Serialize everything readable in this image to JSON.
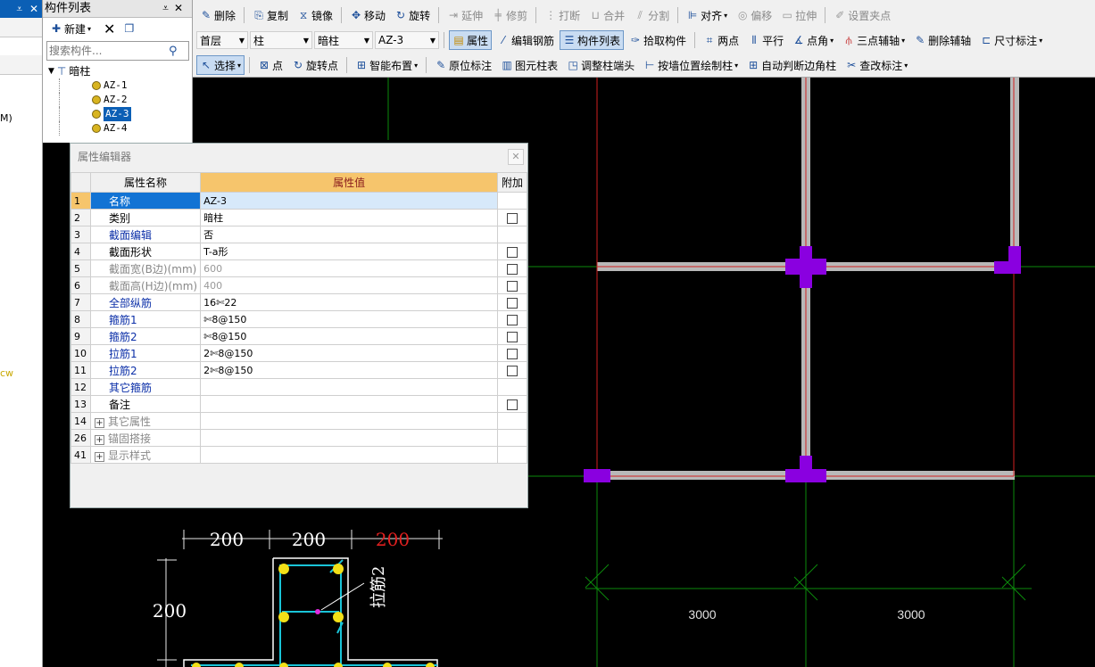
{
  "left_panel": {
    "pin_label": "⩡",
    "close_label": "✕",
    "fragment_1": "M)",
    "fragment_2": "cw"
  },
  "component_list": {
    "title": "构件列表",
    "pin_label": "⩡",
    "close_label": "✕",
    "new_label": "新建",
    "search_placeholder": "搜索构件...",
    "tree_root": "暗柱",
    "items": [
      "AZ-1",
      "AZ-2",
      "AZ-3",
      "AZ-4"
    ],
    "selected": "AZ-3"
  },
  "toolbar1": {
    "delete": "删除",
    "copy": "复制",
    "mirror": "镜像",
    "move": "移动",
    "rotate": "旋转",
    "extend": "延伸",
    "trim": "修剪",
    "break": "打断",
    "merge": "合并",
    "split": "分割",
    "align": "对齐",
    "offset": "偏移",
    "stretch": "拉伸",
    "set_grip": "设置夹点"
  },
  "toolbar2": {
    "floor": "首层",
    "type": "柱",
    "subtype": "暗柱",
    "component": "AZ-3",
    "properties": "属性",
    "edit_rebar": "编辑钢筋",
    "component_list": "构件列表",
    "pick_component": "拾取构件",
    "two_points": "两点",
    "parallel": "平行",
    "point_angle": "点角",
    "three_point_axis": "三点辅轴",
    "delete_axis": "删除辅轴",
    "dimension": "尺寸标注"
  },
  "toolbar3": {
    "select": "选择",
    "point": "点",
    "rotate_point": "旋转点",
    "smart_layout": "智能布置",
    "in_place_label": "原位标注",
    "element_column_table": "图元柱表",
    "adjust_column_end": "调整柱端头",
    "draw_by_wall": "按墙位置绘制柱",
    "auto_corner_column": "自动判断边角柱",
    "check_label": "查改标注"
  },
  "property_editor": {
    "title": "属性编辑器",
    "close_label": "✕",
    "headers": [
      "属性名称",
      "属性值",
      "附加"
    ],
    "rows": [
      {
        "num": "1",
        "name": "名称",
        "value": "AZ-3",
        "style": "blue",
        "check": false,
        "selected": true
      },
      {
        "num": "2",
        "name": "类别",
        "value": "暗柱",
        "style": "normal",
        "check": true
      },
      {
        "num": "3",
        "name": "截面编辑",
        "value": "否",
        "style": "blue",
        "check": false
      },
      {
        "num": "4",
        "name": "截面形状",
        "value": "T-a形",
        "style": "normal",
        "check": true
      },
      {
        "num": "5",
        "name": "截面宽(B边)(mm)",
        "value": "600",
        "style": "gray",
        "check": true
      },
      {
        "num": "6",
        "name": "截面高(H边)(mm)",
        "value": "400",
        "style": "gray",
        "check": true
      },
      {
        "num": "7",
        "name": "全部纵筋",
        "value": "16✄22",
        "style": "blue",
        "check": true
      },
      {
        "num": "8",
        "name": "箍筋1",
        "value": "✄8@150",
        "style": "blue",
        "check": true
      },
      {
        "num": "9",
        "name": "箍筋2",
        "value": "✄8@150",
        "style": "blue",
        "check": true
      },
      {
        "num": "10",
        "name": "拉筋1",
        "value": "2✄8@150",
        "style": "blue",
        "check": true
      },
      {
        "num": "11",
        "name": "拉筋2",
        "value": "2✄8@150",
        "style": "blue",
        "check": true
      },
      {
        "num": "12",
        "name": "其它箍筋",
        "value": "",
        "style": "blue",
        "check": false
      },
      {
        "num": "13",
        "name": "备注",
        "value": "",
        "style": "normal",
        "check": true
      },
      {
        "num": "14",
        "name": "其它属性",
        "value": "",
        "style": "gray",
        "check": false,
        "expand": true
      },
      {
        "num": "26",
        "name": "锚固搭接",
        "value": "",
        "style": "gray",
        "check": false,
        "expand": true
      },
      {
        "num": "41",
        "name": "显示样式",
        "value": "",
        "style": "gray",
        "check": false,
        "expand": true
      }
    ]
  },
  "section_preview": {
    "dim_top_1": "200",
    "dim_top_2": "200",
    "dim_top_3": "200",
    "dim_left": "200",
    "rebar_label": "拉筋2"
  },
  "canvas": {
    "dim_1": "3000",
    "dim_2": "3000",
    "colors": {
      "column": "#8a00e0",
      "wall": "#b8b8b8",
      "axis": "#d02020",
      "grid": "#0c8a0c"
    }
  }
}
